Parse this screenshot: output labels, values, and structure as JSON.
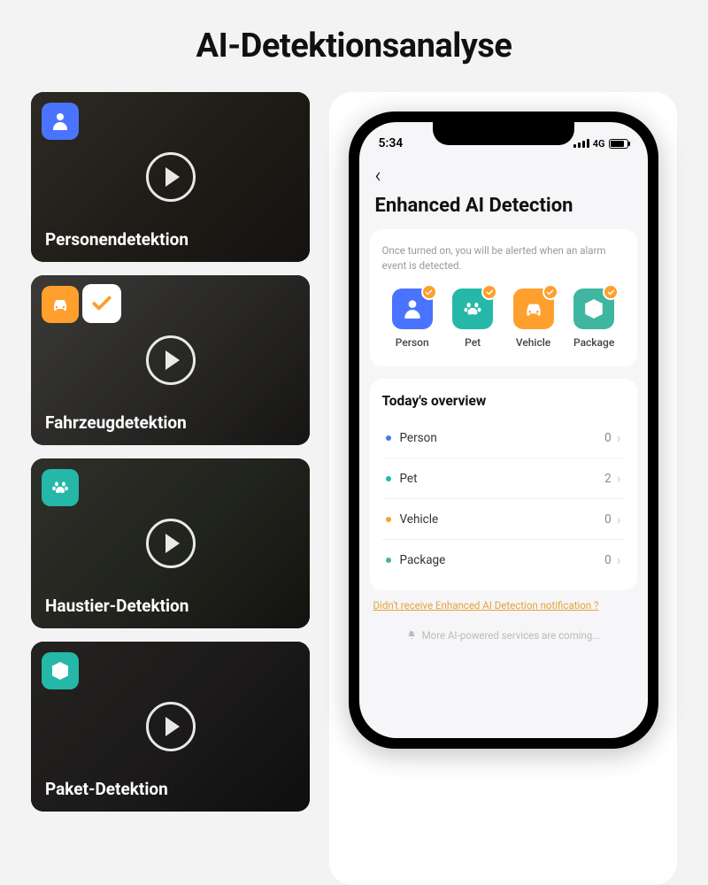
{
  "page_title": "AI-Detektionsanalyse",
  "tiles": [
    {
      "label": "Personendetektion",
      "icon": "person",
      "icon_color": "blue",
      "selected": false
    },
    {
      "label": "Fahrzeugdetektion",
      "icon": "car",
      "icon_color": "orange",
      "selected": true
    },
    {
      "label": "Haustier-Detektion",
      "icon": "pet",
      "icon_color": "teal",
      "selected": false
    },
    {
      "label": "Paket-Detektion",
      "icon": "package",
      "icon_color": "teal",
      "selected": false
    }
  ],
  "phone": {
    "status": {
      "time": "5:34",
      "network": "4G"
    },
    "screen_title": "Enhanced AI Detection",
    "desc": "Once turned on, you will be alerted when an alarm event is detected.",
    "detections": [
      {
        "label": "Person",
        "color": "blue",
        "checked": true
      },
      {
        "label": "Pet",
        "color": "teal",
        "checked": true
      },
      {
        "label": "Vehicle",
        "color": "orange",
        "checked": true
      },
      {
        "label": "Package",
        "color": "teal2",
        "checked": true
      }
    ],
    "overview_title": "Today's overview",
    "overview": [
      {
        "label": "Person",
        "count": "0",
        "dot": "blue"
      },
      {
        "label": "Pet",
        "count": "2",
        "dot": "teal"
      },
      {
        "label": "Vehicle",
        "count": "0",
        "dot": "orange"
      },
      {
        "label": "Package",
        "count": "0",
        "dot": "teal2"
      }
    ],
    "help_link": "Didn't receive Enhanced AI Detection notification ?",
    "coming": "More AI-powered services are coming..."
  }
}
